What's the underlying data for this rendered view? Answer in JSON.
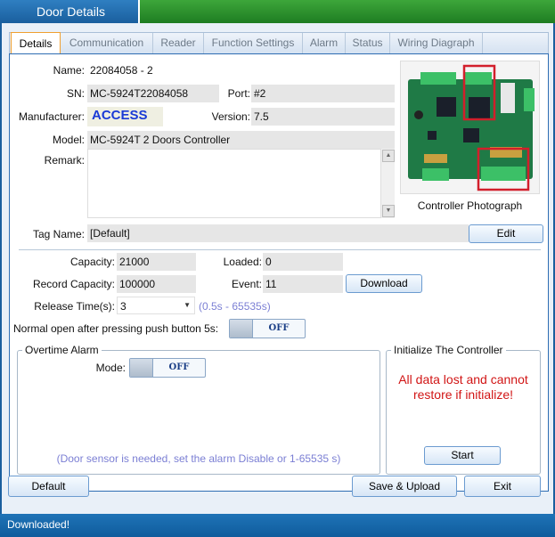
{
  "window": {
    "title": "Door Details"
  },
  "tabs": [
    {
      "label": "Details",
      "active": true
    },
    {
      "label": "Communication"
    },
    {
      "label": "Reader"
    },
    {
      "label": "Function Settings"
    },
    {
      "label": "Alarm"
    },
    {
      "label": "Status"
    },
    {
      "label": "Wiring Diagraph"
    }
  ],
  "details": {
    "name_label": "Name:",
    "name_value": "22084058 - 2",
    "sn_label": "SN:",
    "sn_value": "MC-5924T22084058",
    "port_label": "Port:",
    "port_value": "#2",
    "manufacturer_label": "Manufacturer:",
    "manufacturer_value": "ACCESS",
    "version_label": "Version:",
    "version_value": "7.5",
    "model_label": "Model:",
    "model_value": "MC-5924T 2 Doors Controller",
    "remark_label": "Remark:",
    "remark_value": "",
    "photo_caption": "Controller Photograph",
    "tag_label": "Tag Name:",
    "tag_value": "[Default]",
    "edit_button": "Edit"
  },
  "records": {
    "capacity_label": "Capacity:",
    "capacity_value": "21000",
    "loaded_label": "Loaded:",
    "loaded_value": "0",
    "record_capacity_label": "Record Capacity:",
    "record_capacity_value": "100000",
    "event_label": "Event:",
    "event_value": "11",
    "download_button": "Download",
    "release_label": "Release Time(s):",
    "release_value": "3",
    "release_hint": "(0.5s - 65535s)",
    "normal_open_label": "Normal open after pressing push button 5s:",
    "normal_open_toggle": "OFF"
  },
  "overtime": {
    "title": "Overtime Alarm",
    "mode_label": "Mode:",
    "mode_toggle": "OFF",
    "hint": "(Door sensor is needed, set the alarm Disable or 1-65535 s)"
  },
  "initialize": {
    "title": "Initialize The Controller",
    "warning_line1": "All data lost and cannot",
    "warning_line2": "restore if initialize!",
    "start_button": "Start"
  },
  "footer": {
    "default_button": "Default",
    "save_button": "Save & Upload",
    "exit_button": "Exit"
  },
  "status": {
    "message": "Downloaded!"
  },
  "colors": {
    "accent_blue": "#1f6fb5",
    "title_green": "#2a9a2e",
    "hint_blue": "#7b7fd4",
    "warning_red": "#d11515",
    "manufacturer_blue": "#1a3ad6"
  }
}
